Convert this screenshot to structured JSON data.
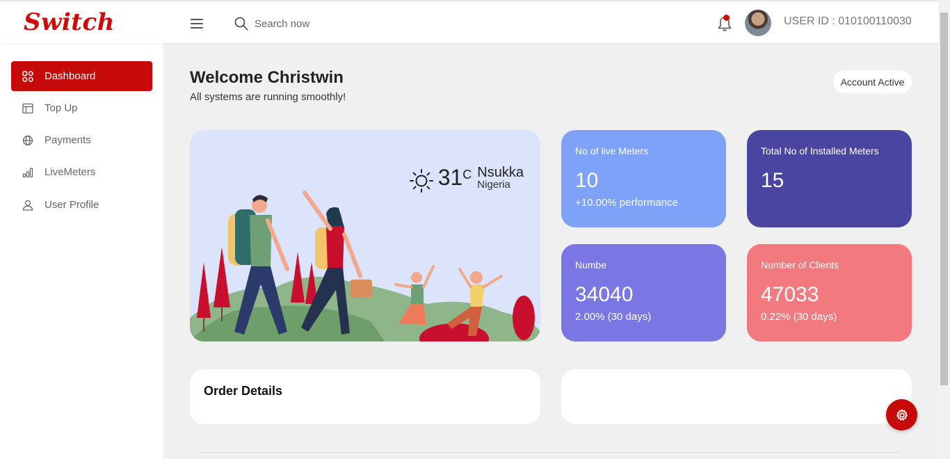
{
  "header": {
    "logo": "Switch",
    "search_placeholder": "Search now",
    "user_id": "USER ID : 010100110030",
    "icons": [
      "menu-icon",
      "search-icon",
      "bell-icon"
    ]
  },
  "sidebar": {
    "items": [
      {
        "label": "Dashboard",
        "icon": "grid-icon",
        "active": true
      },
      {
        "label": "Top Up",
        "icon": "layout-icon",
        "active": false
      },
      {
        "label": "Payments",
        "icon": "globe-icon",
        "active": false
      },
      {
        "label": "LiveMeters",
        "icon": "bar-chart-icon",
        "active": false
      },
      {
        "label": "User Profile",
        "icon": "user-icon",
        "active": false
      }
    ]
  },
  "main": {
    "title": "Welcome Christwin",
    "subtitle": "All systems are running smoothly!",
    "status_badge": "Account Active",
    "weather": {
      "temp": "31",
      "unit": "C",
      "city": "Nsukka",
      "country": "Nigeria"
    },
    "stats": [
      {
        "label": "No of live Meters",
        "value": "10",
        "sub": "+10.00% performance",
        "color": "#7da2f8"
      },
      {
        "label": "Total No of Installed Meters",
        "value": "15",
        "sub": "",
        "color": "#4a45a0"
      },
      {
        "label": "Numbe",
        "value": "34040",
        "sub": "2.00% (30 days)",
        "color": "#7a77e5"
      },
      {
        "label": "Number of Clients",
        "value": "47033",
        "sub": "0.22% (30 days)",
        "color": "#f27a7e"
      }
    ],
    "order_title": "Order Details"
  },
  "colors": {
    "accent": "#c60a0a",
    "background": "#f0f0f0"
  }
}
